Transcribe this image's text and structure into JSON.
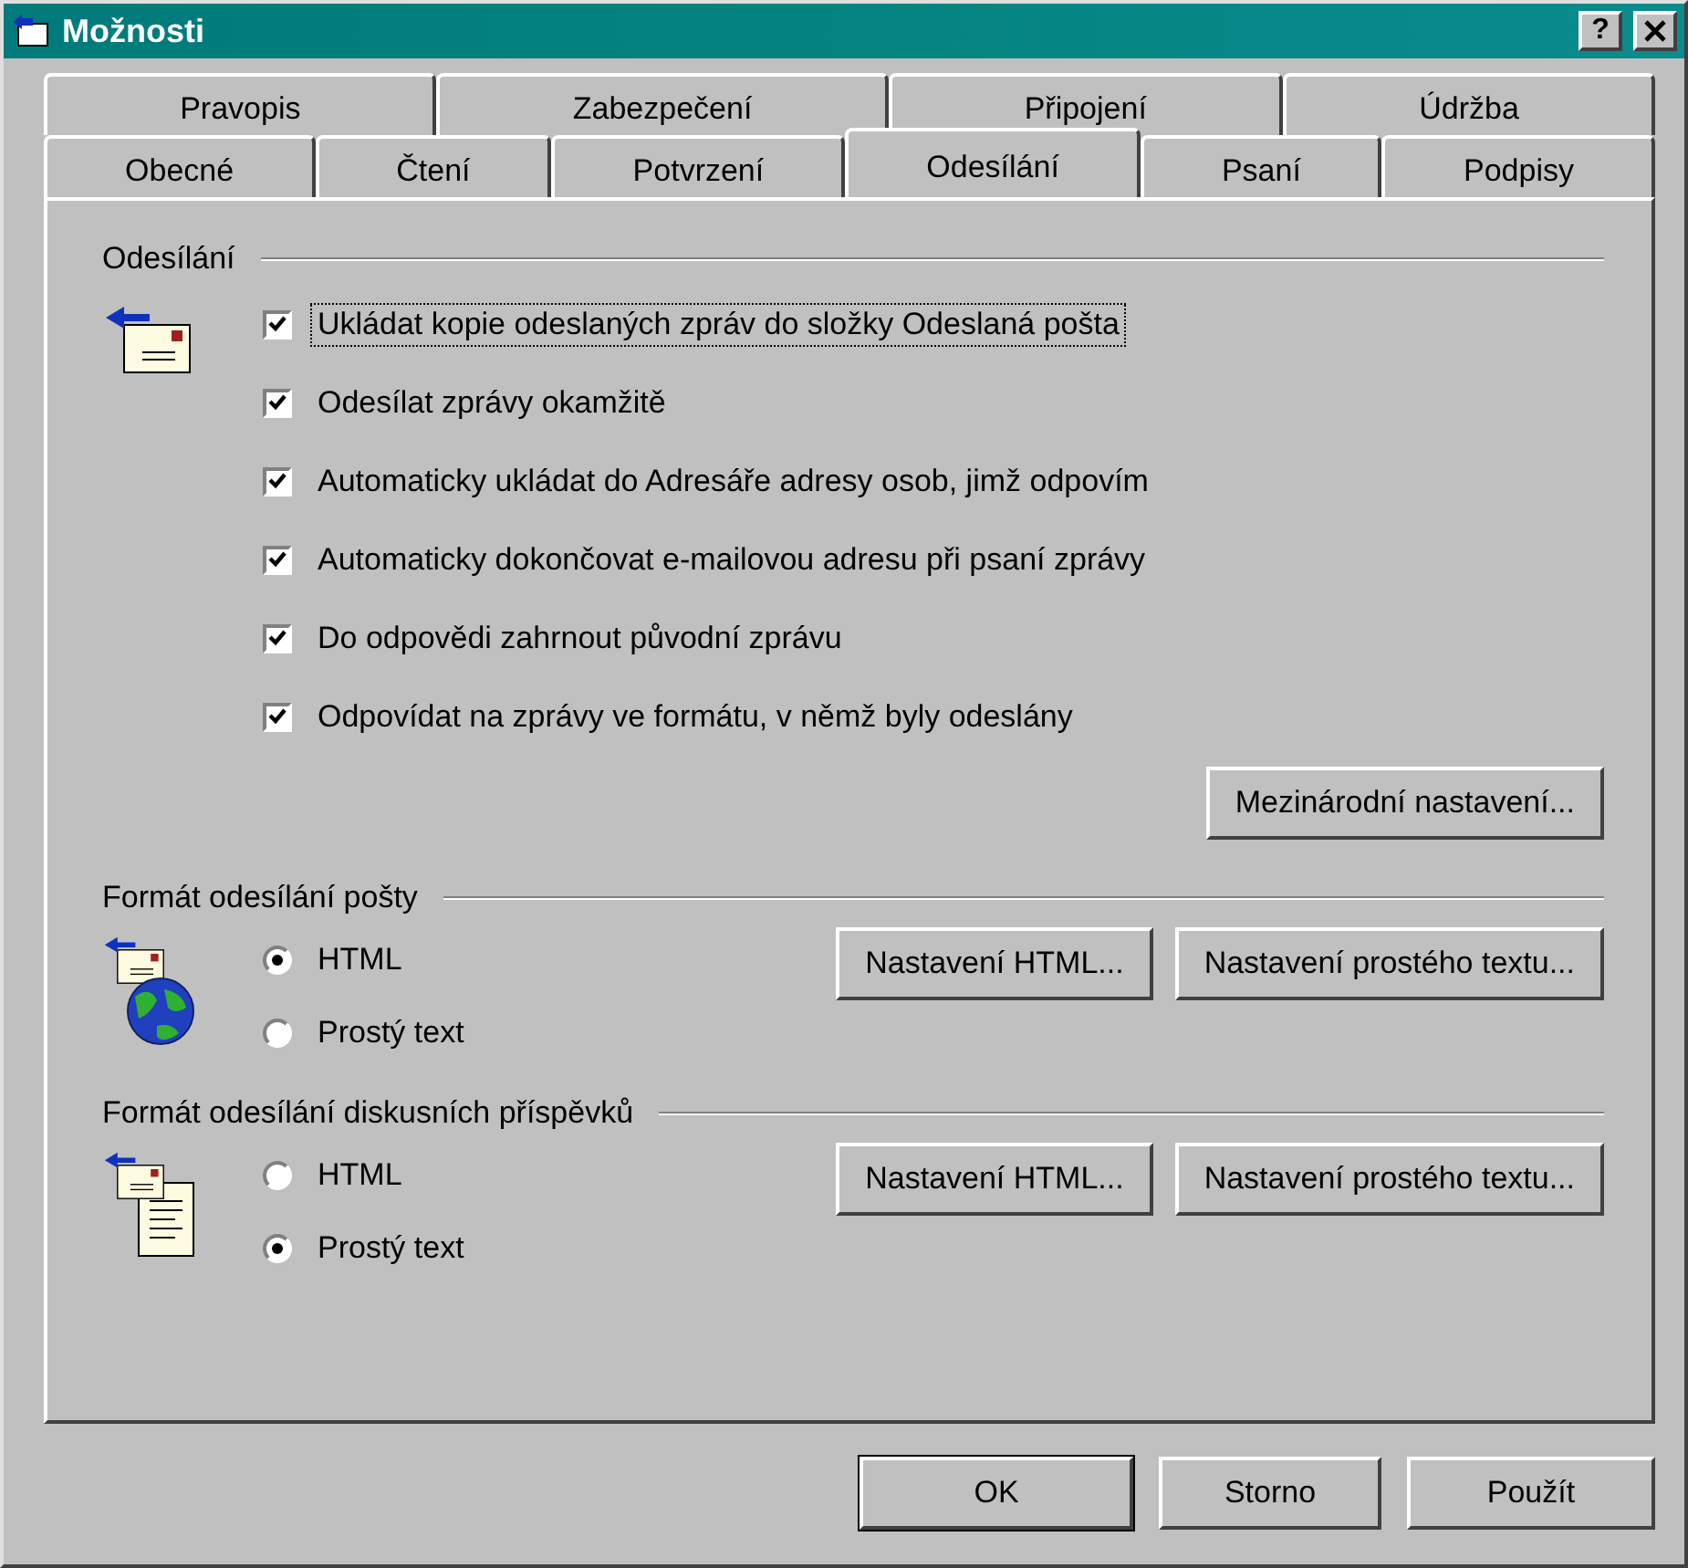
{
  "window": {
    "title": "Možnosti",
    "help_button": "?"
  },
  "tab_rows": [
    [
      {
        "label": "Pravopis",
        "selected": false
      },
      {
        "label": "Zabezpečení",
        "selected": false
      },
      {
        "label": "Připojení",
        "selected": false
      },
      {
        "label": "Údržba",
        "selected": false
      }
    ],
    [
      {
        "label": "Obecné",
        "selected": false
      },
      {
        "label": "Čtení",
        "selected": false
      },
      {
        "label": "Potvrzení",
        "selected": false
      },
      {
        "label": "Odesílání",
        "selected": true
      },
      {
        "label": "Psaní",
        "selected": false
      },
      {
        "label": "Podpisy",
        "selected": false
      }
    ]
  ],
  "sections": [
    {
      "title": "Odesílání",
      "kind": "checkboxes",
      "options": [
        {
          "label": "Ukládat kopie odeslaných zpráv do složky Odeslaná pošta",
          "checked": true,
          "focused": true
        },
        {
          "label": "Odesílat zprávy okamžitě",
          "checked": true,
          "focused": false
        },
        {
          "label": "Automaticky ukládat do Adresáře adresy osob, jimž odpovím",
          "checked": true,
          "focused": false
        },
        {
          "label": "Automaticky dokončovat e-mailovou adresu při psaní zprávy",
          "checked": true,
          "focused": false
        },
        {
          "label": "Do odpovědi zahrnout původní zprávu",
          "checked": true,
          "focused": false
        },
        {
          "label": "Odpovídat na zprávy ve formátu, v němž byly odeslány",
          "checked": true,
          "focused": false
        }
      ],
      "buttons": [
        "Mezinárodní nastavení..."
      ]
    },
    {
      "title": "Formát odesílání pošty",
      "kind": "radios",
      "options": [
        {
          "label": "HTML",
          "selected": true
        },
        {
          "label": "Prostý text",
          "selected": false
        }
      ],
      "buttons": [
        "Nastavení HTML...",
        "Nastavení prostého textu..."
      ]
    },
    {
      "title": "Formát odesílání diskusních příspěvků",
      "kind": "radios",
      "options": [
        {
          "label": "HTML",
          "selected": false
        },
        {
          "label": "Prostý text",
          "selected": true
        }
      ],
      "buttons": [
        "Nastavení HTML...",
        "Nastavení prostého textu..."
      ]
    }
  ],
  "footer_buttons": [
    {
      "label": "OK",
      "default": true
    },
    {
      "label": "Storno",
      "default": false
    },
    {
      "label": "Použít",
      "default": false
    }
  ]
}
